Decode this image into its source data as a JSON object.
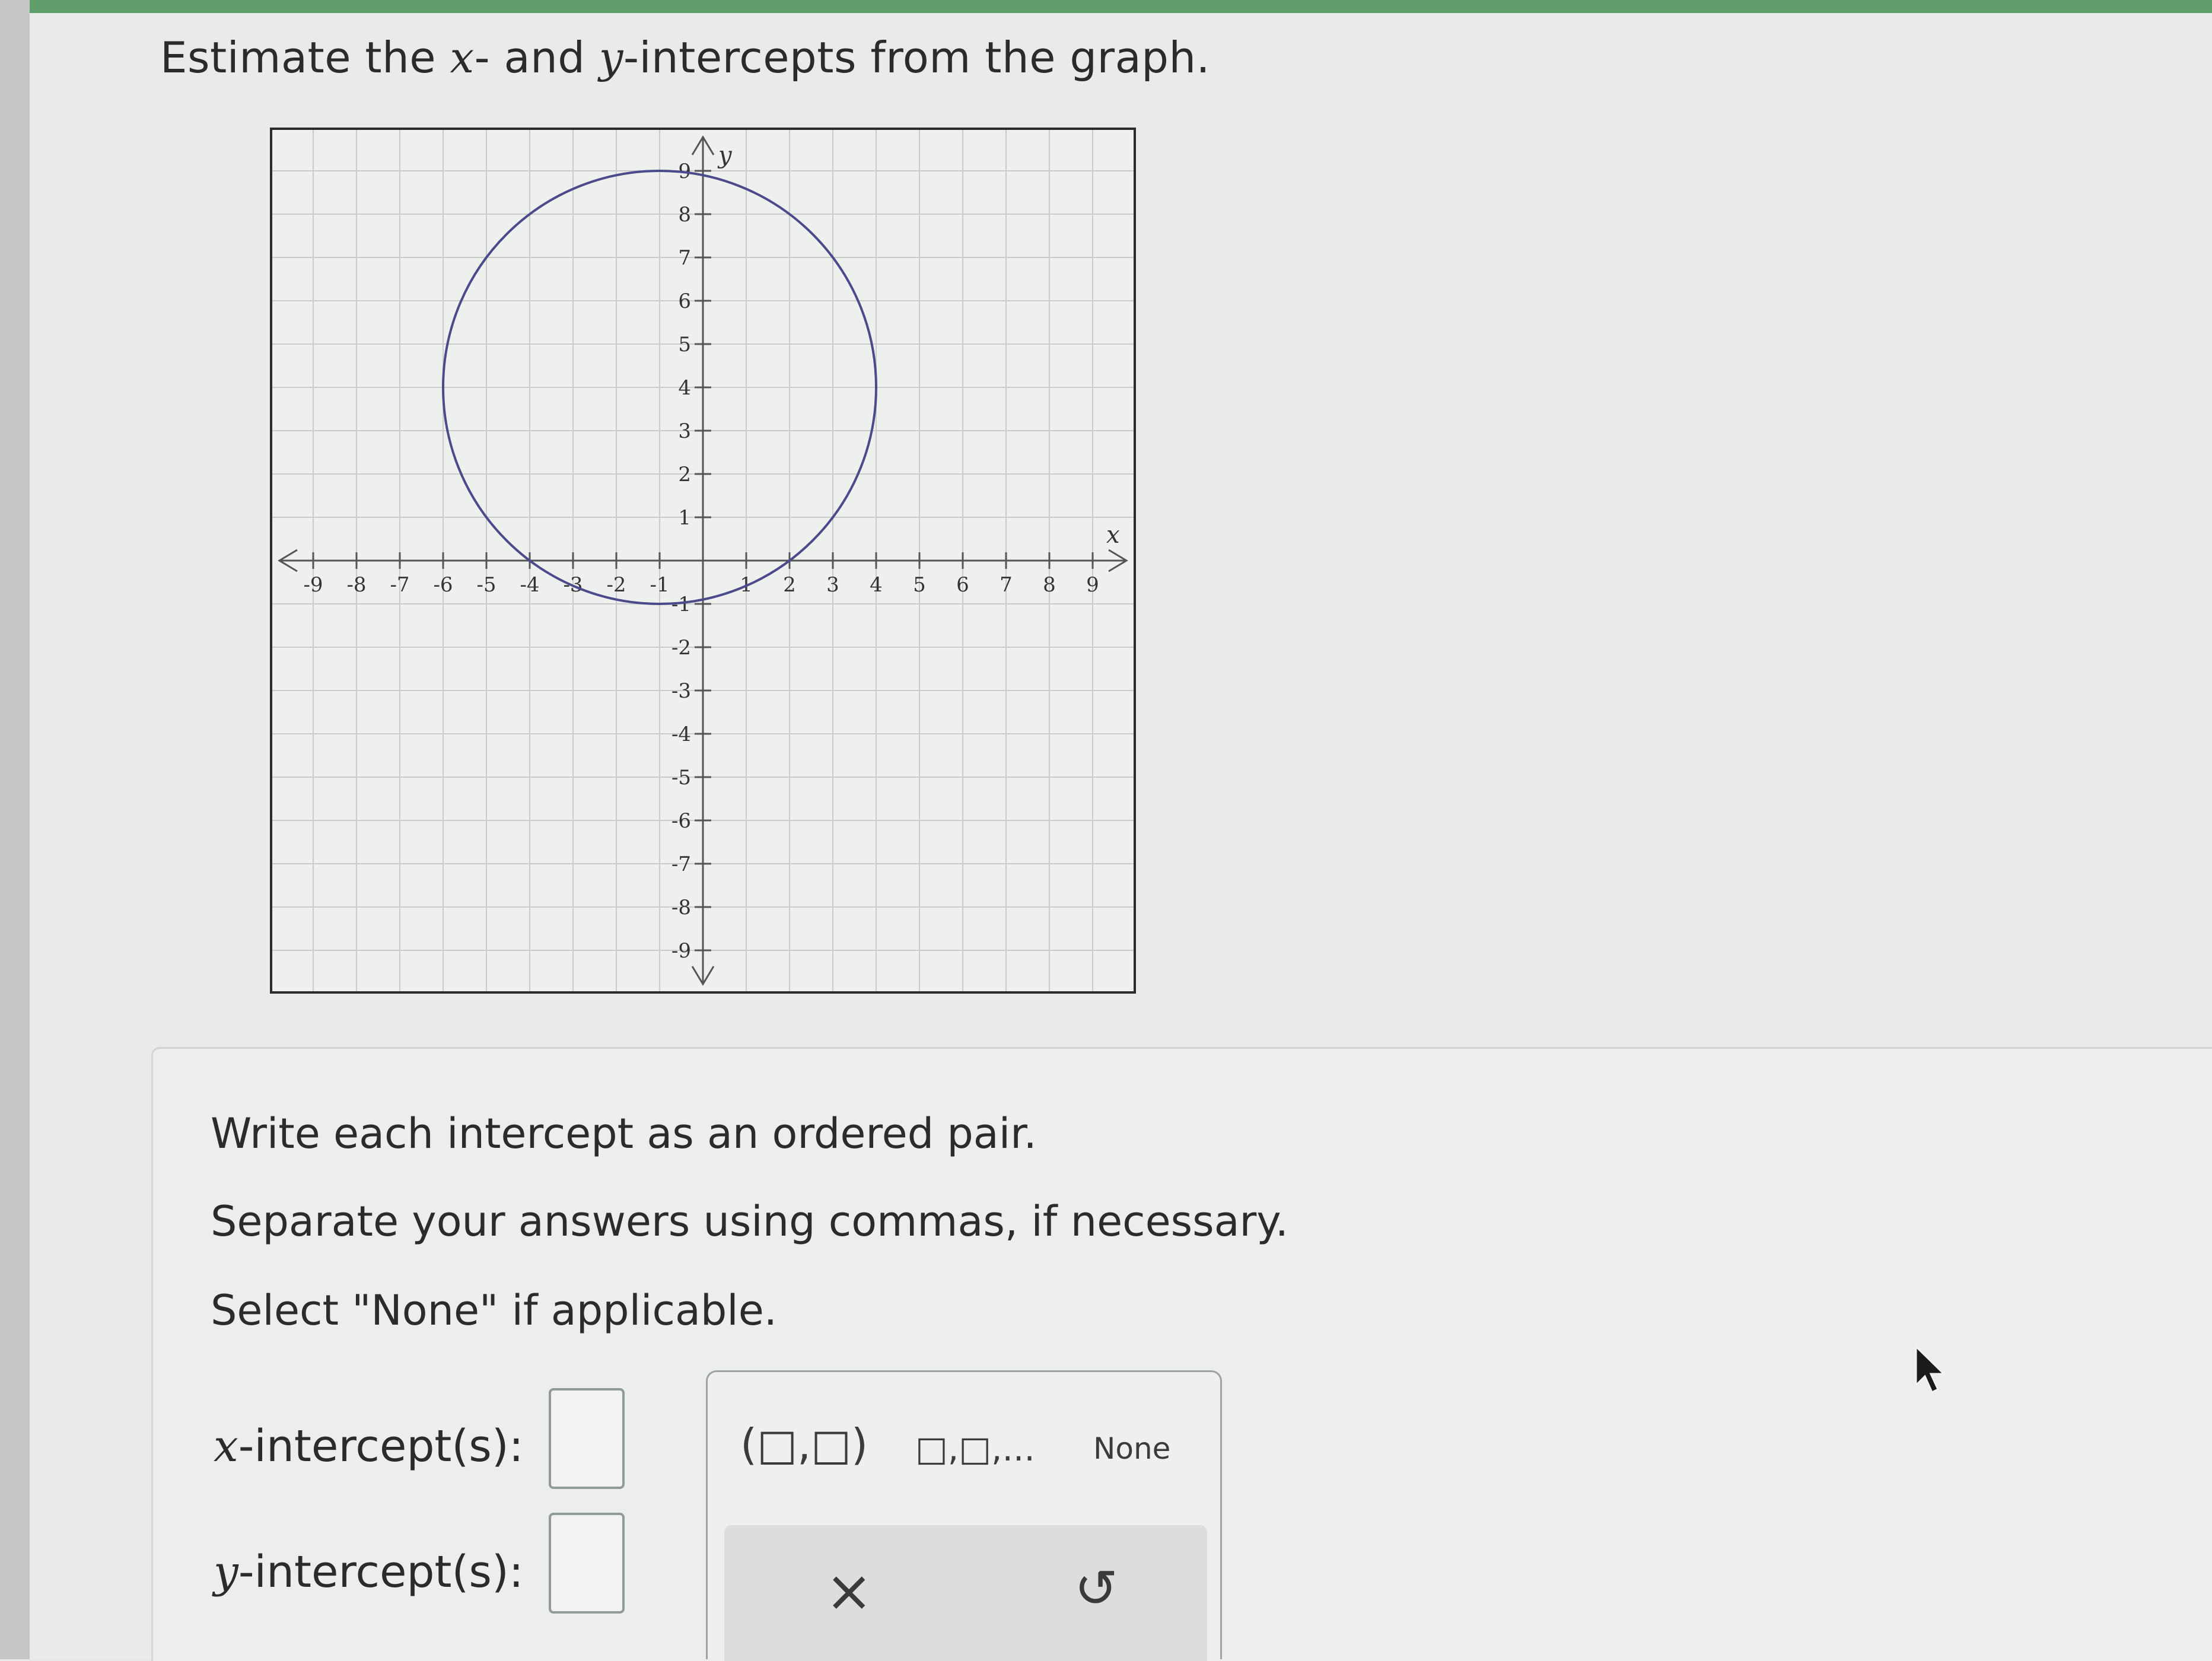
{
  "question": {
    "prefix": "Estimate the",
    "x_var": "x",
    "middle": "- and",
    "y_var": "y",
    "suffix": "-intercepts from the graph."
  },
  "graph": {
    "x_axis_label": "x",
    "y_axis_label": "y",
    "xlim": [
      -10,
      10
    ],
    "ylim": [
      -10,
      10
    ],
    "tick_labels": [
      -9,
      -8,
      -7,
      -6,
      -5,
      -4,
      -3,
      -2,
      -1,
      1,
      2,
      3,
      4,
      5,
      6,
      7,
      8,
      9
    ],
    "grid": true,
    "curve": {
      "type": "circle",
      "center": [
        -1,
        4
      ],
      "radius": 5,
      "color": "#4b4b8c"
    }
  },
  "instructions": [
    "Write each intercept as an ordered pair.",
    "Separate your answers using commas, if necessary.",
    "Select \"None\" if applicable."
  ],
  "answers": {
    "x_label_var": "x",
    "x_label_text": "-intercept(s):",
    "x_value": "",
    "y_label_var": "y",
    "y_label_text": "-intercept(s):",
    "y_value": ""
  },
  "keypad": {
    "ordered_pair": "(□,□)",
    "list": "□,□,...",
    "none": "None",
    "clear_icon": "×",
    "undo_icon": "↺"
  },
  "colors": {
    "grid": "#c9ccca",
    "axis": "#555555",
    "curve": "#4b4b8c",
    "input_border": "#8f9b94"
  }
}
